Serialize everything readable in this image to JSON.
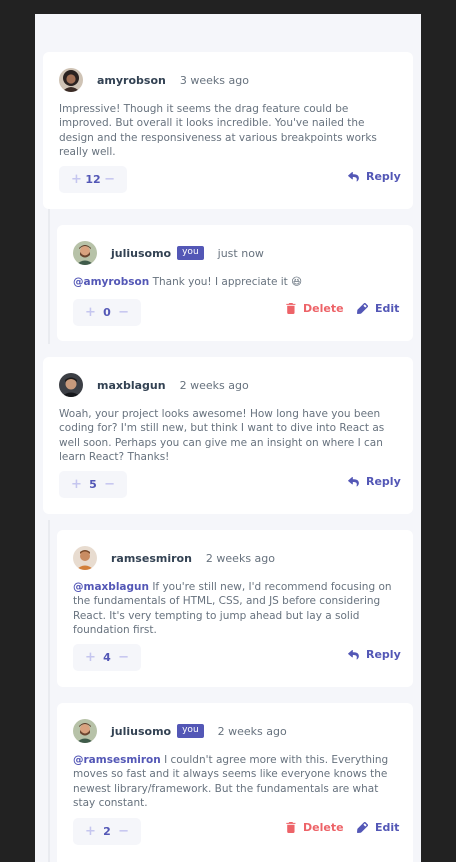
{
  "colors": {
    "accent": "#5357b6",
    "danger": "#ed6368",
    "text_muted": "#67727e",
    "text_dark": "#334253",
    "backdrop": "#222222"
  },
  "comments": [
    {
      "username": "amyrobson",
      "time": "3 weeks ago",
      "mention": "",
      "text": "Impressive! Though it seems the drag feature could be improved. But overall it looks incredible. You've nailed the design and the responsiveness at various breakpoints works really well.",
      "score": "12",
      "action": "Reply",
      "avatar": "amyrobson-avatar"
    },
    {
      "username": "juliusomo",
      "badge": "you",
      "time": "just now",
      "mention": "@amyrobson",
      "text": "Thank you! I appreciate it 😆",
      "score": "0",
      "delete_label": "Delete",
      "edit_label": "Edit",
      "avatar": "juliusomo-avatar"
    },
    {
      "username": "maxblagun",
      "time": "2 weeks ago",
      "mention": "",
      "text": "Woah, your project looks awesome! How long have you been coding for? I'm still new, but think I want to dive into React as well soon. Perhaps you can give me an insight on where I can learn React? Thanks!",
      "score": "5",
      "action": "Reply",
      "avatar": "maxblagun-avatar"
    },
    {
      "username": "ramsesmiron",
      "time": "2 weeks ago",
      "mention": "@maxblagun",
      "text": "If you're still new, I'd recommend focusing on the fundamentals of HTML, CSS, and JS before considering React. It's very tempting to jump ahead but lay a solid foundation first.",
      "score": "4",
      "action": "Reply",
      "avatar": "ramsesmiron-avatar"
    },
    {
      "username": "juliusomo",
      "badge": "you",
      "time": "2 weeks ago",
      "mention": "@ramsesmiron",
      "text": "I couldn't agree more with this. Everything moves so fast and it always seems like everyone knows the newest library/framework. But the fundamentals are what stay constant.",
      "score": "2",
      "delete_label": "Delete",
      "edit_label": "Edit",
      "avatar": "juliusomo-avatar"
    }
  ],
  "vote_plus": "+",
  "vote_minus": "−"
}
